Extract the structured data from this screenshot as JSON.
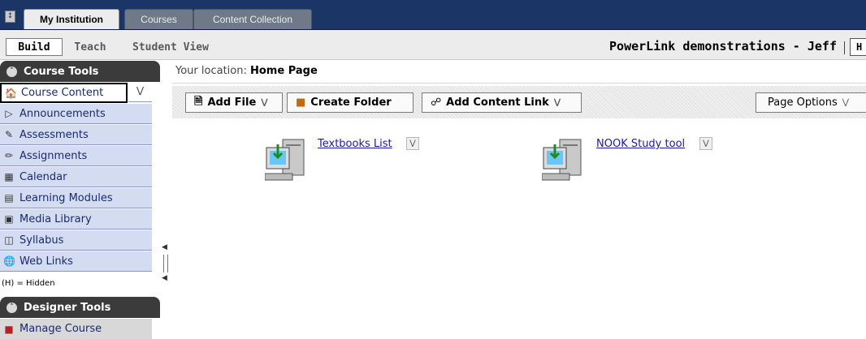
{
  "topbar": {
    "tabs": [
      {
        "label": "My Institution",
        "active": true
      },
      {
        "label": "Courses",
        "active": false
      },
      {
        "label": "Content Collection",
        "active": false
      }
    ]
  },
  "modebar": {
    "modes": [
      "Build",
      "Teach",
      "Student View"
    ],
    "selected_mode": "Build",
    "course_title": "PowerLink demonstrations - Jeff",
    "help_label": "H"
  },
  "sidebar": {
    "course_tools_title": "Course Tools",
    "items": [
      {
        "label": "Course Content",
        "icon": "home-icon"
      },
      {
        "label": "Announcements",
        "icon": "megaphone-icon"
      },
      {
        "label": "Assessments",
        "icon": "assessment-icon"
      },
      {
        "label": "Assignments",
        "icon": "assignment-icon"
      },
      {
        "label": "Calendar",
        "icon": "calendar-icon"
      },
      {
        "label": "Learning Modules",
        "icon": "modules-icon"
      },
      {
        "label": "Media Library",
        "icon": "media-icon"
      },
      {
        "label": "Syllabus",
        "icon": "syllabus-icon"
      },
      {
        "label": "Web Links",
        "icon": "globe-icon"
      }
    ],
    "hidden_note": "(H) = Hidden",
    "designer_tools_title": "Designer Tools",
    "designer_items": [
      {
        "label": "Manage Course",
        "icon": "toolbox-icon"
      }
    ]
  },
  "main": {
    "location_label": "Your location:",
    "location_value": "Home Page",
    "actions": {
      "add_file": "Add File",
      "create_folder": "Create Folder",
      "add_content_link": "Add Content Link",
      "page_options": "Page Options"
    },
    "items": [
      {
        "label": "Textbooks List",
        "icon": "computer-download-icon"
      },
      {
        "label": "NOOK Study tool",
        "icon": "computer-download-icon"
      }
    ]
  }
}
